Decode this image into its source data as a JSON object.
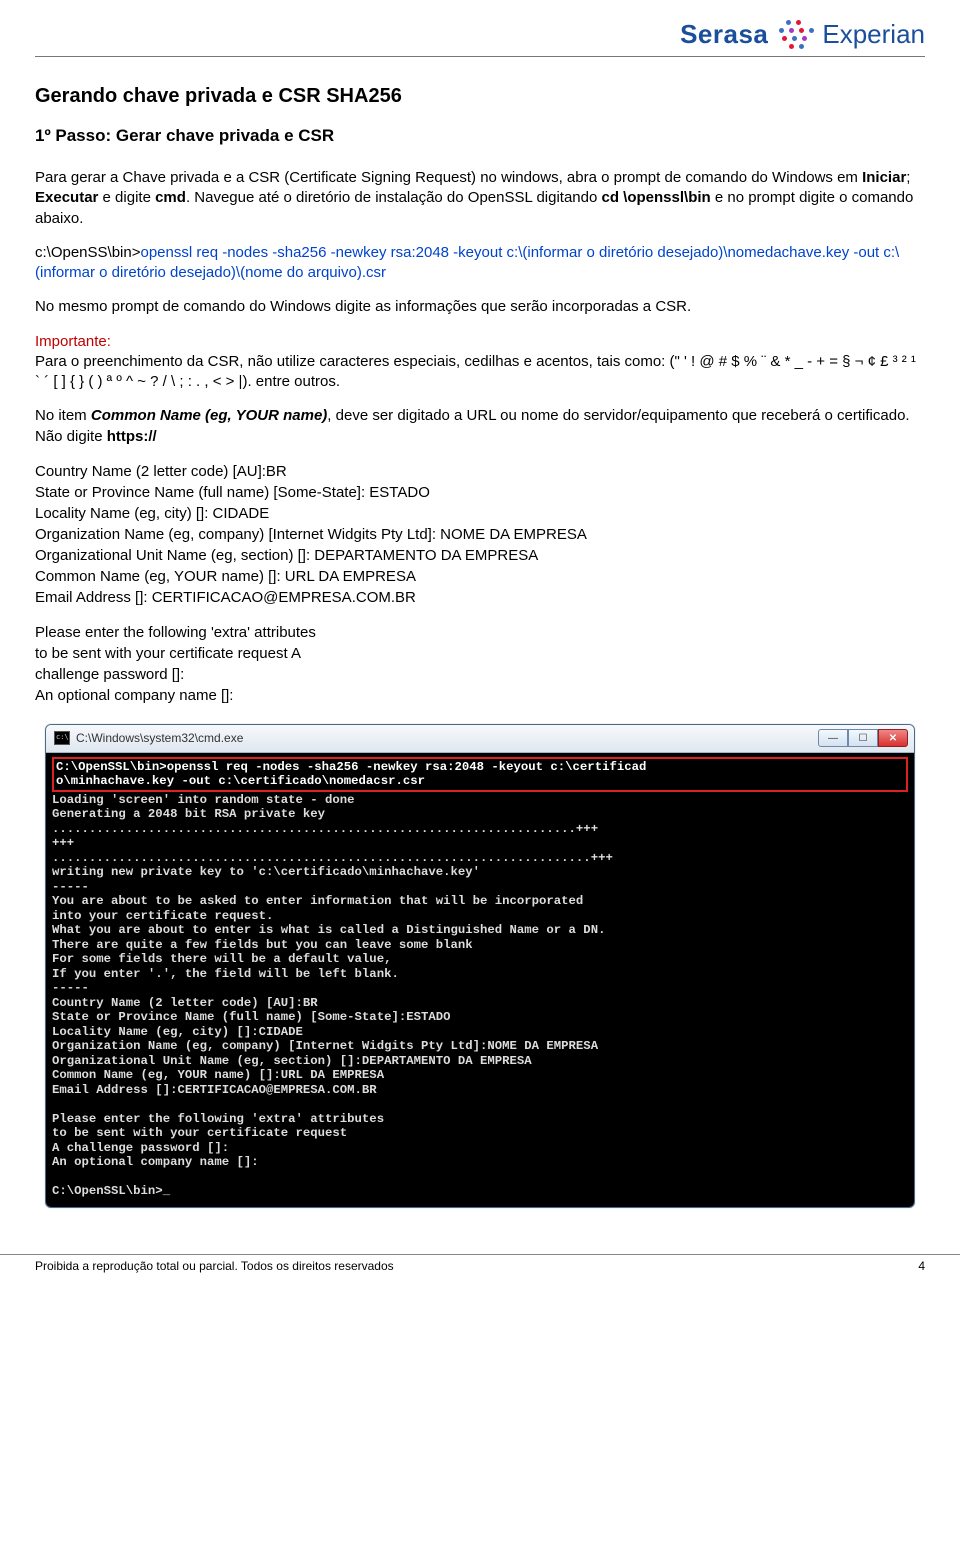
{
  "logo": {
    "left": "Serasa",
    "right": "Experian"
  },
  "h1": "Gerando chave privada e CSR SHA256",
  "h2": "1º Passo: Gerar chave privada e CSR",
  "p1_a": "Para gerar a Chave privada e a CSR (Certificate Signing Request) no windows, abra o prompt de comando do Windows em ",
  "p1_b": "Iniciar",
  "p1_c": "; ",
  "p1_d": "Executar",
  "p1_e": " e digite ",
  "p1_f": "cmd",
  "p1_g": ". Navegue até o diretório de instalação do OpenSSL digitando ",
  "p1_h": "cd \\openssl\\bin",
  "p1_i": " e no prompt digite o comando abaixo.",
  "cmd_prefix": "c:\\OpenSS\\bin>",
  "cmd_blue": "openssl req -nodes -sha256 -newkey rsa:2048 -keyout c:\\(informar o diretório desejado)\\nomedachave.key -out c:\\(informar o diretório desejado)\\(nome do arquivo).csr",
  "p2": "No mesmo prompt de comando do Windows digite as informações que serão incorporadas a CSR.",
  "imp_label": "Importante:",
  "imp_text": "Para o preenchimento da CSR, não utilize caracteres especiais, cedilhas e acentos, tais como: (\" ' ! @ # $ % ¨ & * _ - + = § ¬ ¢ £ ³ ² ¹ ` ´ [ ] { } ( ) ª º ^ ~ ? / \\ ; : . , < > |). entre outros.",
  "p3_a": "No item ",
  "p3_b": "Common Name (eg, YOUR name)",
  "p3_c": ", deve ser digitado a URL ou nome do servidor/equipamento que receberá o certificado. Não digite ",
  "p3_d": "https://",
  "csr": {
    "l1": "Country Name (2 letter code) [AU]:BR",
    "l2": "State or Province Name (full name) [Some-State]: ESTADO",
    "l3": "Locality Name (eg, city) []: CIDADE",
    "l4": "Organization Name (eg, company) [Internet Widgits Pty Ltd]: NOME DA EMPRESA",
    "l5": "Organizational Unit Name (eg, section) []: DEPARTAMENTO DA EMPRESA",
    "l6": "Common Name (eg, YOUR name) []: URL DA EMPRESA",
    "l7": "Email Address []: CERTIFICACAO@EMPRESA.COM.BR"
  },
  "extra": {
    "l1": "Please enter the following 'extra' attributes",
    "l2": "to be sent with your certificate request A",
    "l3": "challenge password []:",
    "l4": "An optional company name []:"
  },
  "terminal": {
    "title": "C:\\Windows\\system32\\cmd.exe",
    "highlight": "C:\\OpenSSL\\bin>openssl req -nodes -sha256 -newkey rsa:2048 -keyout c:\\certificad\no\\minhachave.key -out c:\\certificado\\nomedacsr.csr",
    "body": "Loading 'screen' into random state - done\nGenerating a 2048 bit RSA private key\n.......................................................................+++\n+++\n.........................................................................+++\nwriting new private key to 'c:\\certificado\\minhachave.key'\n-----\nYou are about to be asked to enter information that will be incorporated\ninto your certificate request.\nWhat you are about to enter is what is called a Distinguished Name or a DN.\nThere are quite a few fields but you can leave some blank\nFor some fields there will be a default value,\nIf you enter '.', the field will be left blank.\n-----\nCountry Name (2 letter code) [AU]:BR\nState or Province Name (full name) [Some-State]:ESTADO\nLocality Name (eg, city) []:CIDADE\nOrganization Name (eg, company) [Internet Widgits Pty Ltd]:NOME DA EMPRESA\nOrganizational Unit Name (eg, section) []:DEPARTAMENTO DA EMPRESA\nCommon Name (eg, YOUR name) []:URL DA EMPRESA\nEmail Address []:CERTIFICACAO@EMPRESA.COM.BR\n\nPlease enter the following 'extra' attributes\nto be sent with your certificate request\nA challenge password []:\nAn optional company name []:\n\nC:\\OpenSSL\\bin>_"
  },
  "footer": {
    "left": "Proibida a reprodução total ou parcial. Todos os direitos reservados",
    "page": "4"
  }
}
